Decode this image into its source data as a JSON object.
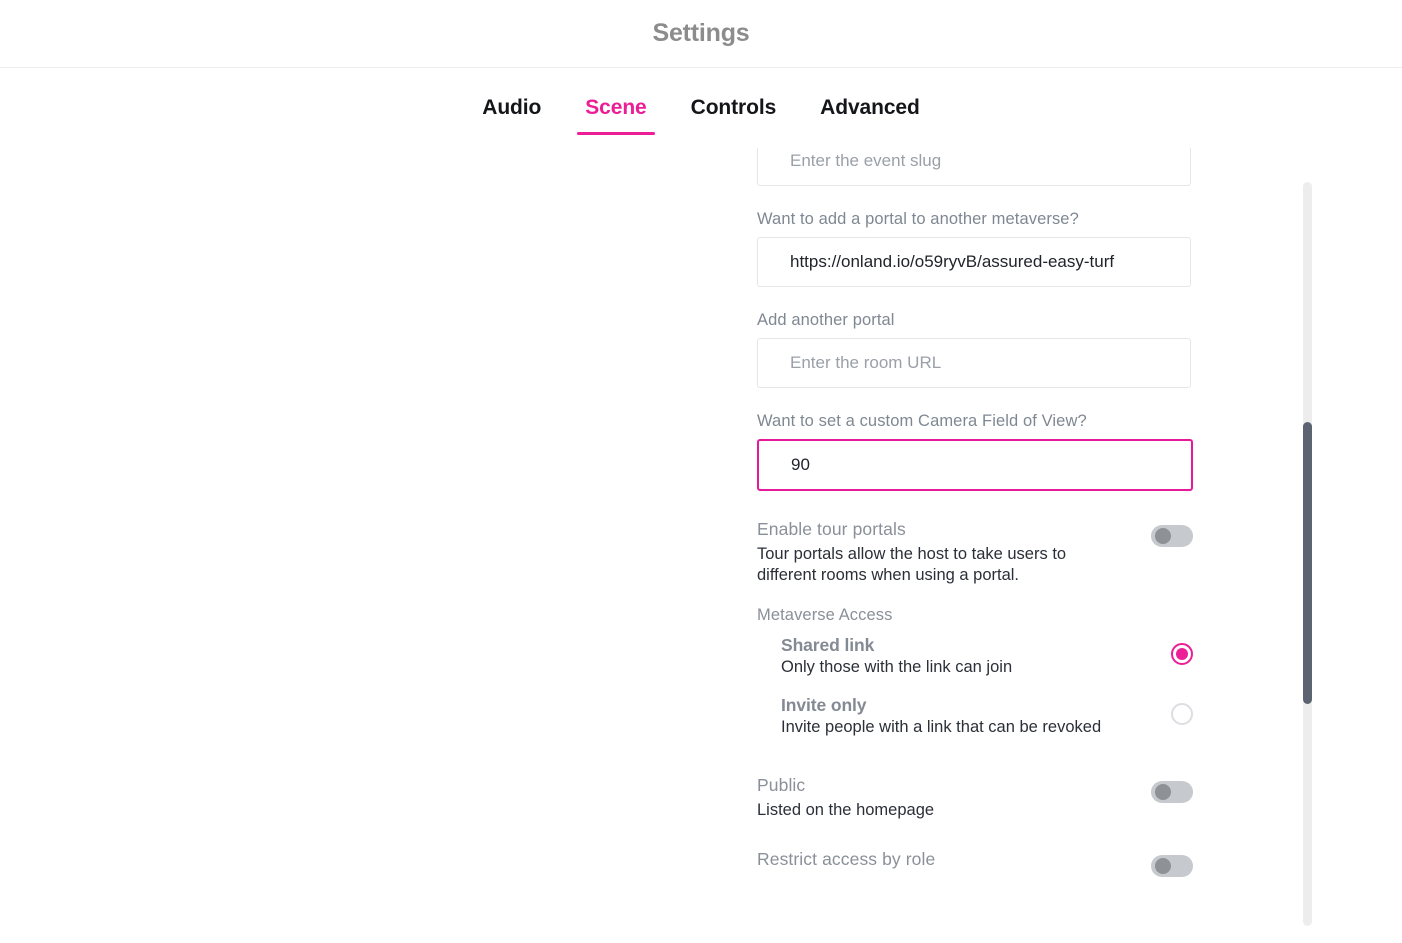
{
  "header": {
    "title": "Settings"
  },
  "tabs": {
    "active": "Scene",
    "accent_color": "#ED1E95",
    "items": [
      {
        "label": "Audio"
      },
      {
        "label": "Scene"
      },
      {
        "label": "Controls"
      },
      {
        "label": "Advanced"
      }
    ]
  },
  "form": {
    "event_slug": {
      "placeholder": "Enter the event slug",
      "value": ""
    },
    "portal_primary": {
      "label": "Want to add a portal to another metaverse?",
      "value": "https://onland.io/o59ryvB/assured-easy-turf",
      "placeholder": ""
    },
    "portal_secondary": {
      "label": "Add another portal",
      "placeholder": "Enter the room URL",
      "value": ""
    },
    "camera_fov": {
      "label": "Want to set a custom Camera Field of View?",
      "value": "90",
      "placeholder": "",
      "focused": true,
      "focus_border_color": "#E6199A"
    },
    "tour_portals": {
      "title": "Enable tour portals",
      "description": "Tour portals allow the host to take users to different rooms when using a portal.",
      "toggle_state": "off"
    },
    "metaverse_access": {
      "label": "Metaverse Access",
      "options": [
        {
          "title": "Shared link",
          "description": "Only those with the link can join",
          "selected": true
        },
        {
          "title": "Invite only",
          "description": "Invite people with a link that can be revoked",
          "selected": false
        }
      ]
    },
    "public": {
      "title": "Public",
      "description": "Listed on the homepage",
      "toggle_state": "off"
    },
    "restrict_by_role": {
      "title": "Restrict access by role",
      "toggle_state": "off"
    }
  },
  "scrollbar": {
    "orientation": "vertical",
    "thumb_color": "#5B6470",
    "track_color": "#EDEDED"
  }
}
